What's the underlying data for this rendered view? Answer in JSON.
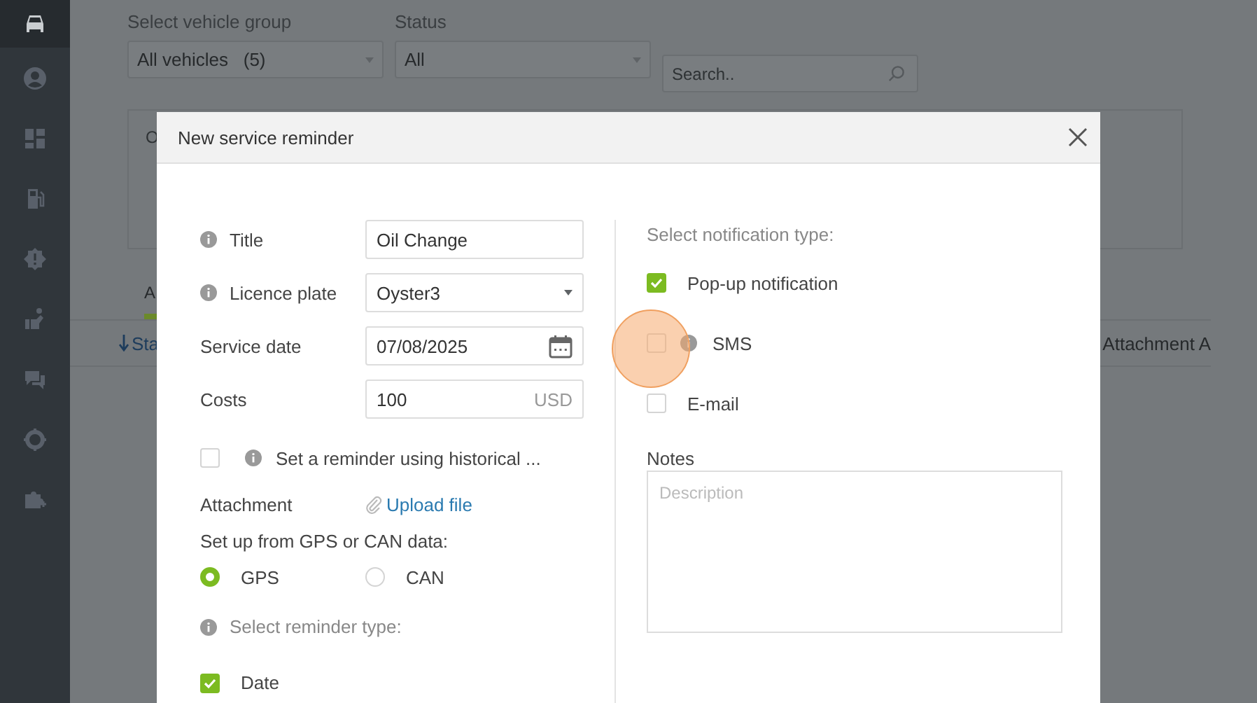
{
  "sidebar": {
    "items": [
      {
        "selected": true
      },
      {
        "selected": false
      },
      {
        "selected": false
      },
      {
        "selected": false
      },
      {
        "selected": false
      },
      {
        "selected": false
      },
      {
        "selected": false
      },
      {
        "selected": false
      },
      {
        "selected": false
      }
    ]
  },
  "filters": [
    {
      "label": "Select vehicle group",
      "value": "All vehicles   (5)"
    },
    {
      "label": "Status",
      "value": "All"
    }
  ],
  "search": {
    "placeholder": "Search.."
  },
  "card": {
    "label": "O"
  },
  "tabs": [
    {
      "label": "A",
      "selected": true
    }
  ],
  "table": {
    "columns": [
      "Sta",
      "Attachment A"
    ]
  },
  "dialog": {
    "title": "New service reminder",
    "fields": [
      {
        "kind": "text",
        "label": "Title",
        "info": true,
        "value": "Oil Change"
      },
      {
        "kind": "select",
        "label": "Licence plate",
        "info": true,
        "value": "Oyster3"
      },
      {
        "kind": "date",
        "label": "Service date",
        "info": false,
        "value": "07/08/2025"
      },
      {
        "kind": "money",
        "label": "Costs",
        "info": false,
        "value": "100",
        "unit": "USD"
      }
    ],
    "historical": {
      "label": "Set a reminder using historical ...",
      "checked": false
    },
    "attachment": {
      "label": "Attachment",
      "link": "Upload file"
    },
    "source": {
      "label": "Set up from GPS or CAN data:",
      "options": [
        {
          "label": "GPS",
          "selected": true
        },
        {
          "label": "CAN",
          "selected": false
        }
      ]
    },
    "reminder_type": {
      "label": "Select reminder type:",
      "options": [
        {
          "label": "Date",
          "checked": true
        }
      ]
    },
    "notification": {
      "label": "Select notification type:",
      "options": [
        {
          "label": "Pop-up notification",
          "info": false,
          "checked": true
        },
        {
          "label": "SMS",
          "info": true,
          "checked": false
        },
        {
          "label": "E-mail",
          "info": false,
          "checked": false
        }
      ]
    },
    "notes": {
      "label": "Notes",
      "placeholder": "Description"
    }
  }
}
